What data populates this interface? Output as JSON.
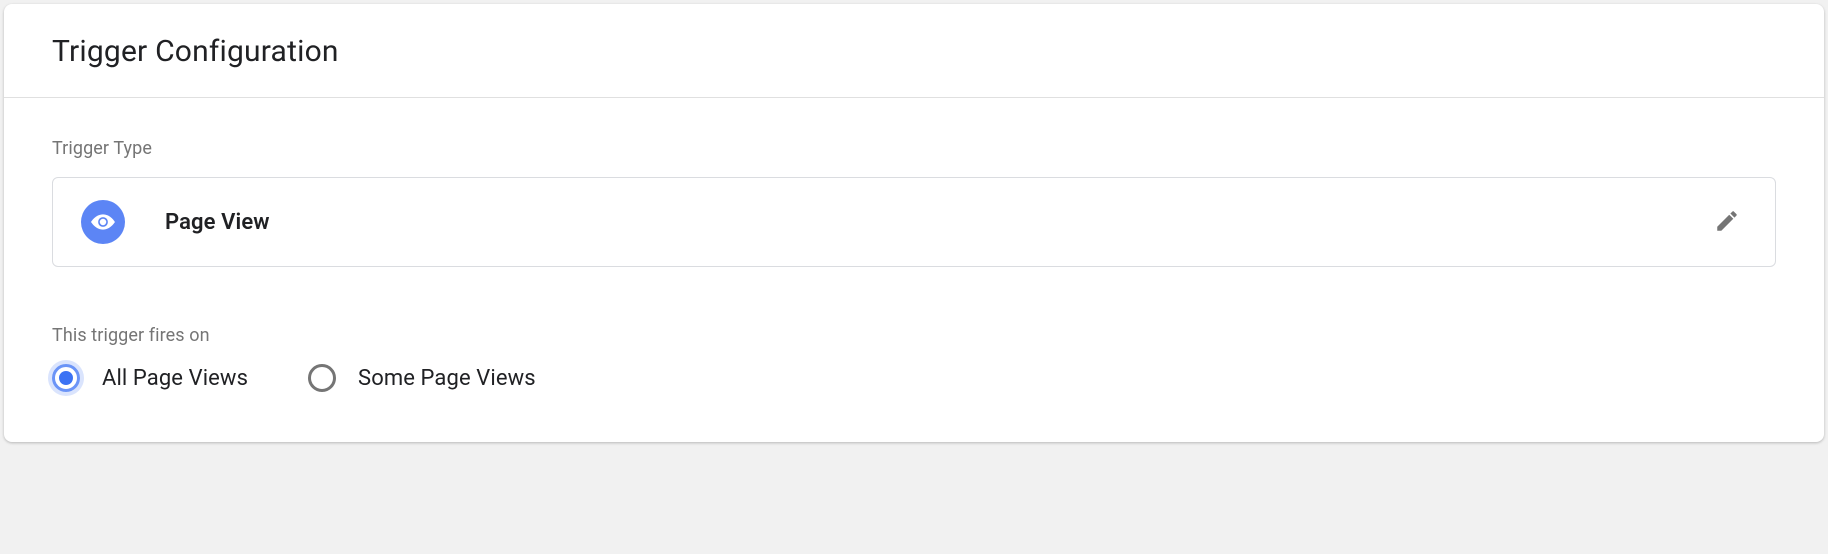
{
  "header": {
    "title": "Trigger Configuration"
  },
  "triggerType": {
    "label": "Trigger Type",
    "value": "Page View"
  },
  "firesOn": {
    "label": "This trigger fires on",
    "options": [
      {
        "label": "All Page Views",
        "selected": true
      },
      {
        "label": "Some Page Views",
        "selected": false
      }
    ]
  }
}
